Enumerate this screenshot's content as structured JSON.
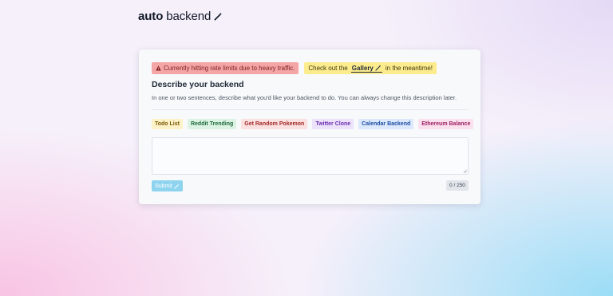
{
  "logo": {
    "bold": "auto",
    "light": "backend"
  },
  "alerts": {
    "rate_limit": "Currently hitting rate limits due to heavy traffic.",
    "gallery_prefix": "Check out the",
    "gallery_link": "Gallery",
    "gallery_suffix": "in the meantime!"
  },
  "form": {
    "title": "Describe your backend",
    "description": "In one or two sentences, describe what you'd like your backend to do. You can always change this description later.",
    "textarea_value": "",
    "submit_label": "Submit",
    "counter": "0 / 250"
  },
  "examples": [
    {
      "label": "Todo List",
      "color": "#7a5a06"
    },
    {
      "label": "Reddit Trending",
      "color": "#1d6b3b"
    },
    {
      "label": "Get Random Pokemon",
      "color": "#a32a2a"
    },
    {
      "label": "Twitter Clone",
      "color": "#6b2fb0"
    },
    {
      "label": "Calendar Backend",
      "color": "#1f4fa5"
    },
    {
      "label": "Ethereum Balance",
      "color": "#9e1f62"
    }
  ],
  "icons": {
    "logo": "magic-wand-icon",
    "warning": "warning-triangle-icon",
    "gallery": "magic-wand-icon",
    "submit": "magic-wand-icon"
  },
  "colors": {
    "submit_bg": "#8fd4ef",
    "error_bg": "#f4a6a6",
    "info_bg": "#fcec8e"
  }
}
